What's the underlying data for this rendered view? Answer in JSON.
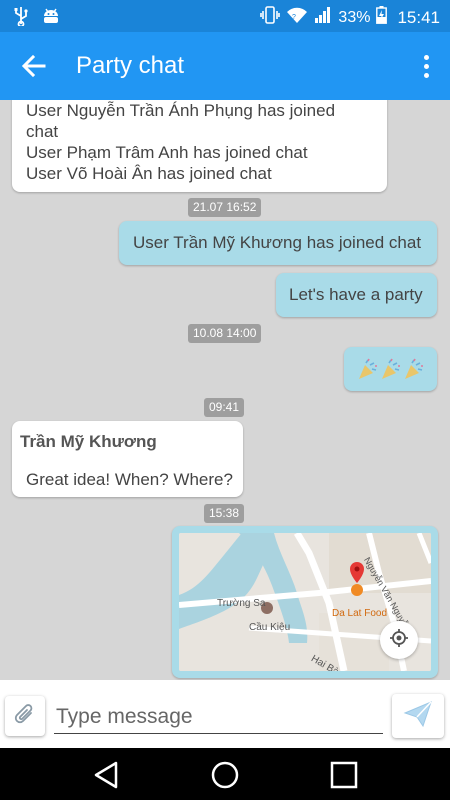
{
  "status_bar": {
    "battery": "33%",
    "time": "15:41",
    "icons": [
      "usb-icon",
      "android-debug-icon",
      "vibrate-icon",
      "wifi-icon",
      "signal-icon",
      "battery-charging-icon"
    ]
  },
  "app_bar": {
    "title": "Party chat",
    "back_icon": "arrow-back-icon",
    "menu_icon": "more-vert-icon"
  },
  "messages": {
    "joined_top": {
      "lines": [
        "User Nguyễn Trần Ánh Phụng has joined",
        "chat",
        "User Phạm Trâm Anh has joined chat",
        "User Võ Hoài Ân has joined chat"
      ]
    },
    "stamp1": "21.07 16:52",
    "me_joined": "User Trần Mỹ Khương has joined chat",
    "party": "Let's have a party",
    "stamp2": "10.08 14:00",
    "emoji": "🎉🎉🎉",
    "stamp3": "09:41",
    "khuong": {
      "sender": "Trần Mỹ Khương",
      "text": "Great idea! When? Where?"
    },
    "stamp4": "15:38",
    "map": {
      "labels": {
        "street1": "Trường Sa",
        "place1": "Cầu Kiệu",
        "place2": "Da Lat Food",
        "street2": "Nguyễn Văn Nguyễn",
        "street3": "Hai Bà"
      }
    }
  },
  "input_bar": {
    "placeholder": "Type message",
    "attach_icon": "paperclip-icon",
    "send_icon": "send-icon"
  },
  "colors": {
    "status_bar": "#1a84d8",
    "app_bar": "#2196f3",
    "outgoing_bubble": "#a9dbe8",
    "incoming_bubble": "#ffffff",
    "chat_background": "#d6d6d6",
    "timestamp": "#9e9e9e"
  }
}
